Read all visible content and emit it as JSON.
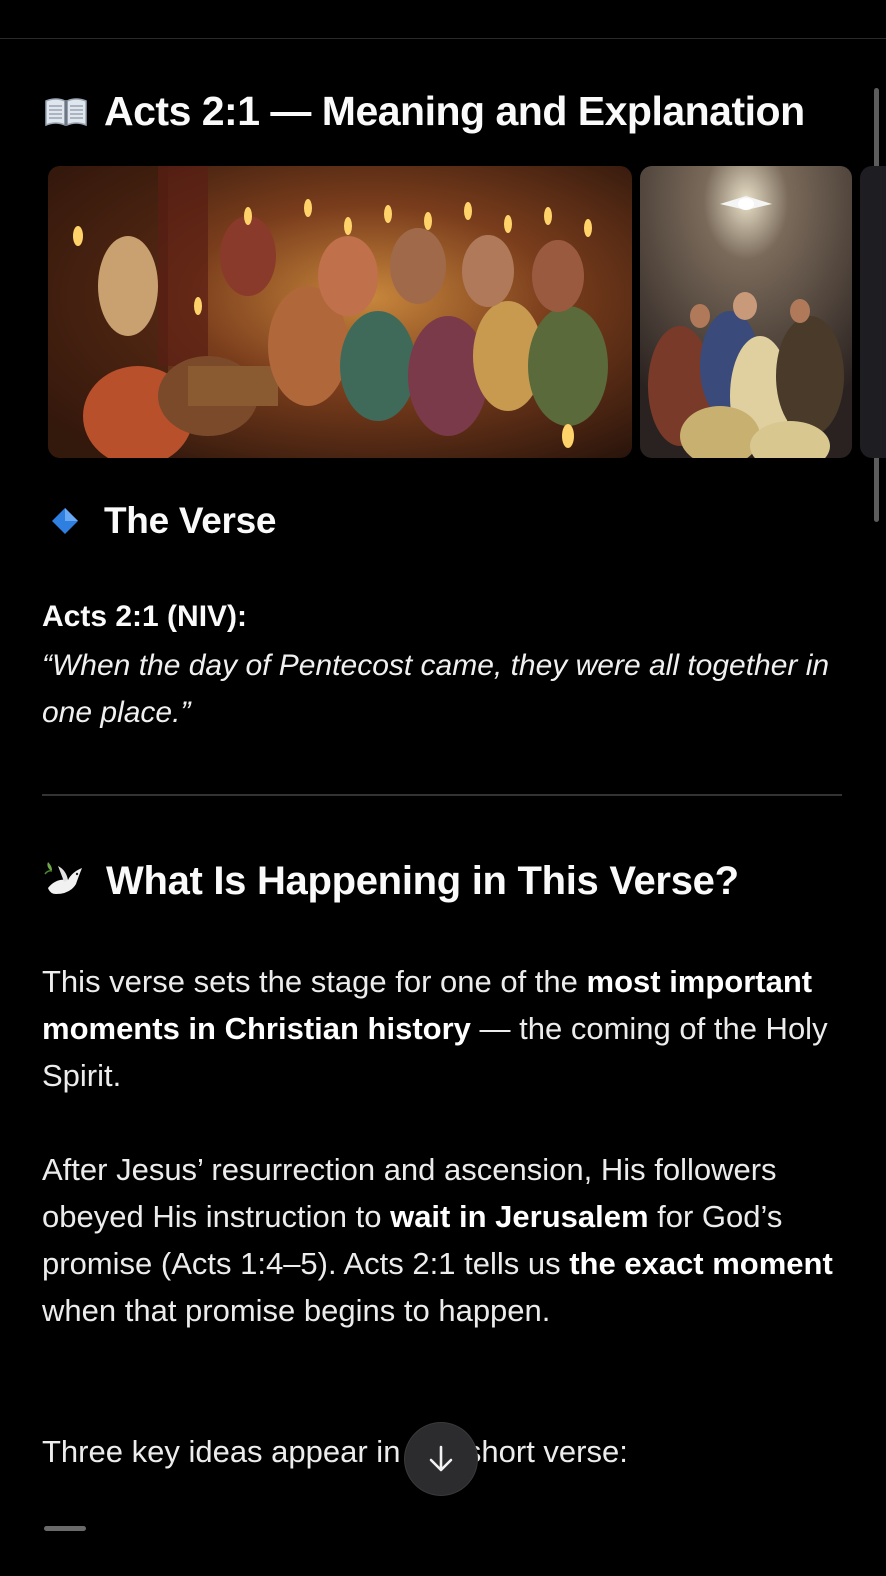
{
  "header": {
    "title_icon": "open-book-icon",
    "title": "Acts 2:1 — Meaning and Explanation"
  },
  "gallery": {
    "images": [
      {
        "icon": "pentecost-painting-image"
      },
      {
        "icon": "pentecost-dove-painting-image"
      },
      {
        "icon": "partial-image"
      }
    ]
  },
  "section_verse": {
    "icon": "blue-diamond-icon",
    "heading": "The Verse",
    "reference": "Acts 2:1 (NIV):",
    "quote": "“When the day of Pentecost came, they were all together in one place.”"
  },
  "section_happening": {
    "icon": "dove-icon",
    "heading": "What Is Happening in This Verse?",
    "p1": {
      "a": "This verse sets the stage for one of the ",
      "b": "most important moments in Christian history",
      "c": " — the coming of the Holy Spirit."
    },
    "p2": {
      "a": "After Jesus’ resurrection and ascension, His followers obeyed His instruction to ",
      "b": "wait in Jerusalem",
      "c": " for God’s promise (Acts 1:4–5). Acts 2:1 tells us ",
      "d": "the exact moment",
      "e": " when that promise begins to happen."
    },
    "p3": "Three key ideas appear in this short verse:"
  },
  "controls": {
    "scroll_down_icon": "arrow-down-icon"
  },
  "colors": {
    "background": "#000000",
    "text": "#f2f2f2",
    "divider": "#333333",
    "diamond": "#2f7fe0"
  }
}
